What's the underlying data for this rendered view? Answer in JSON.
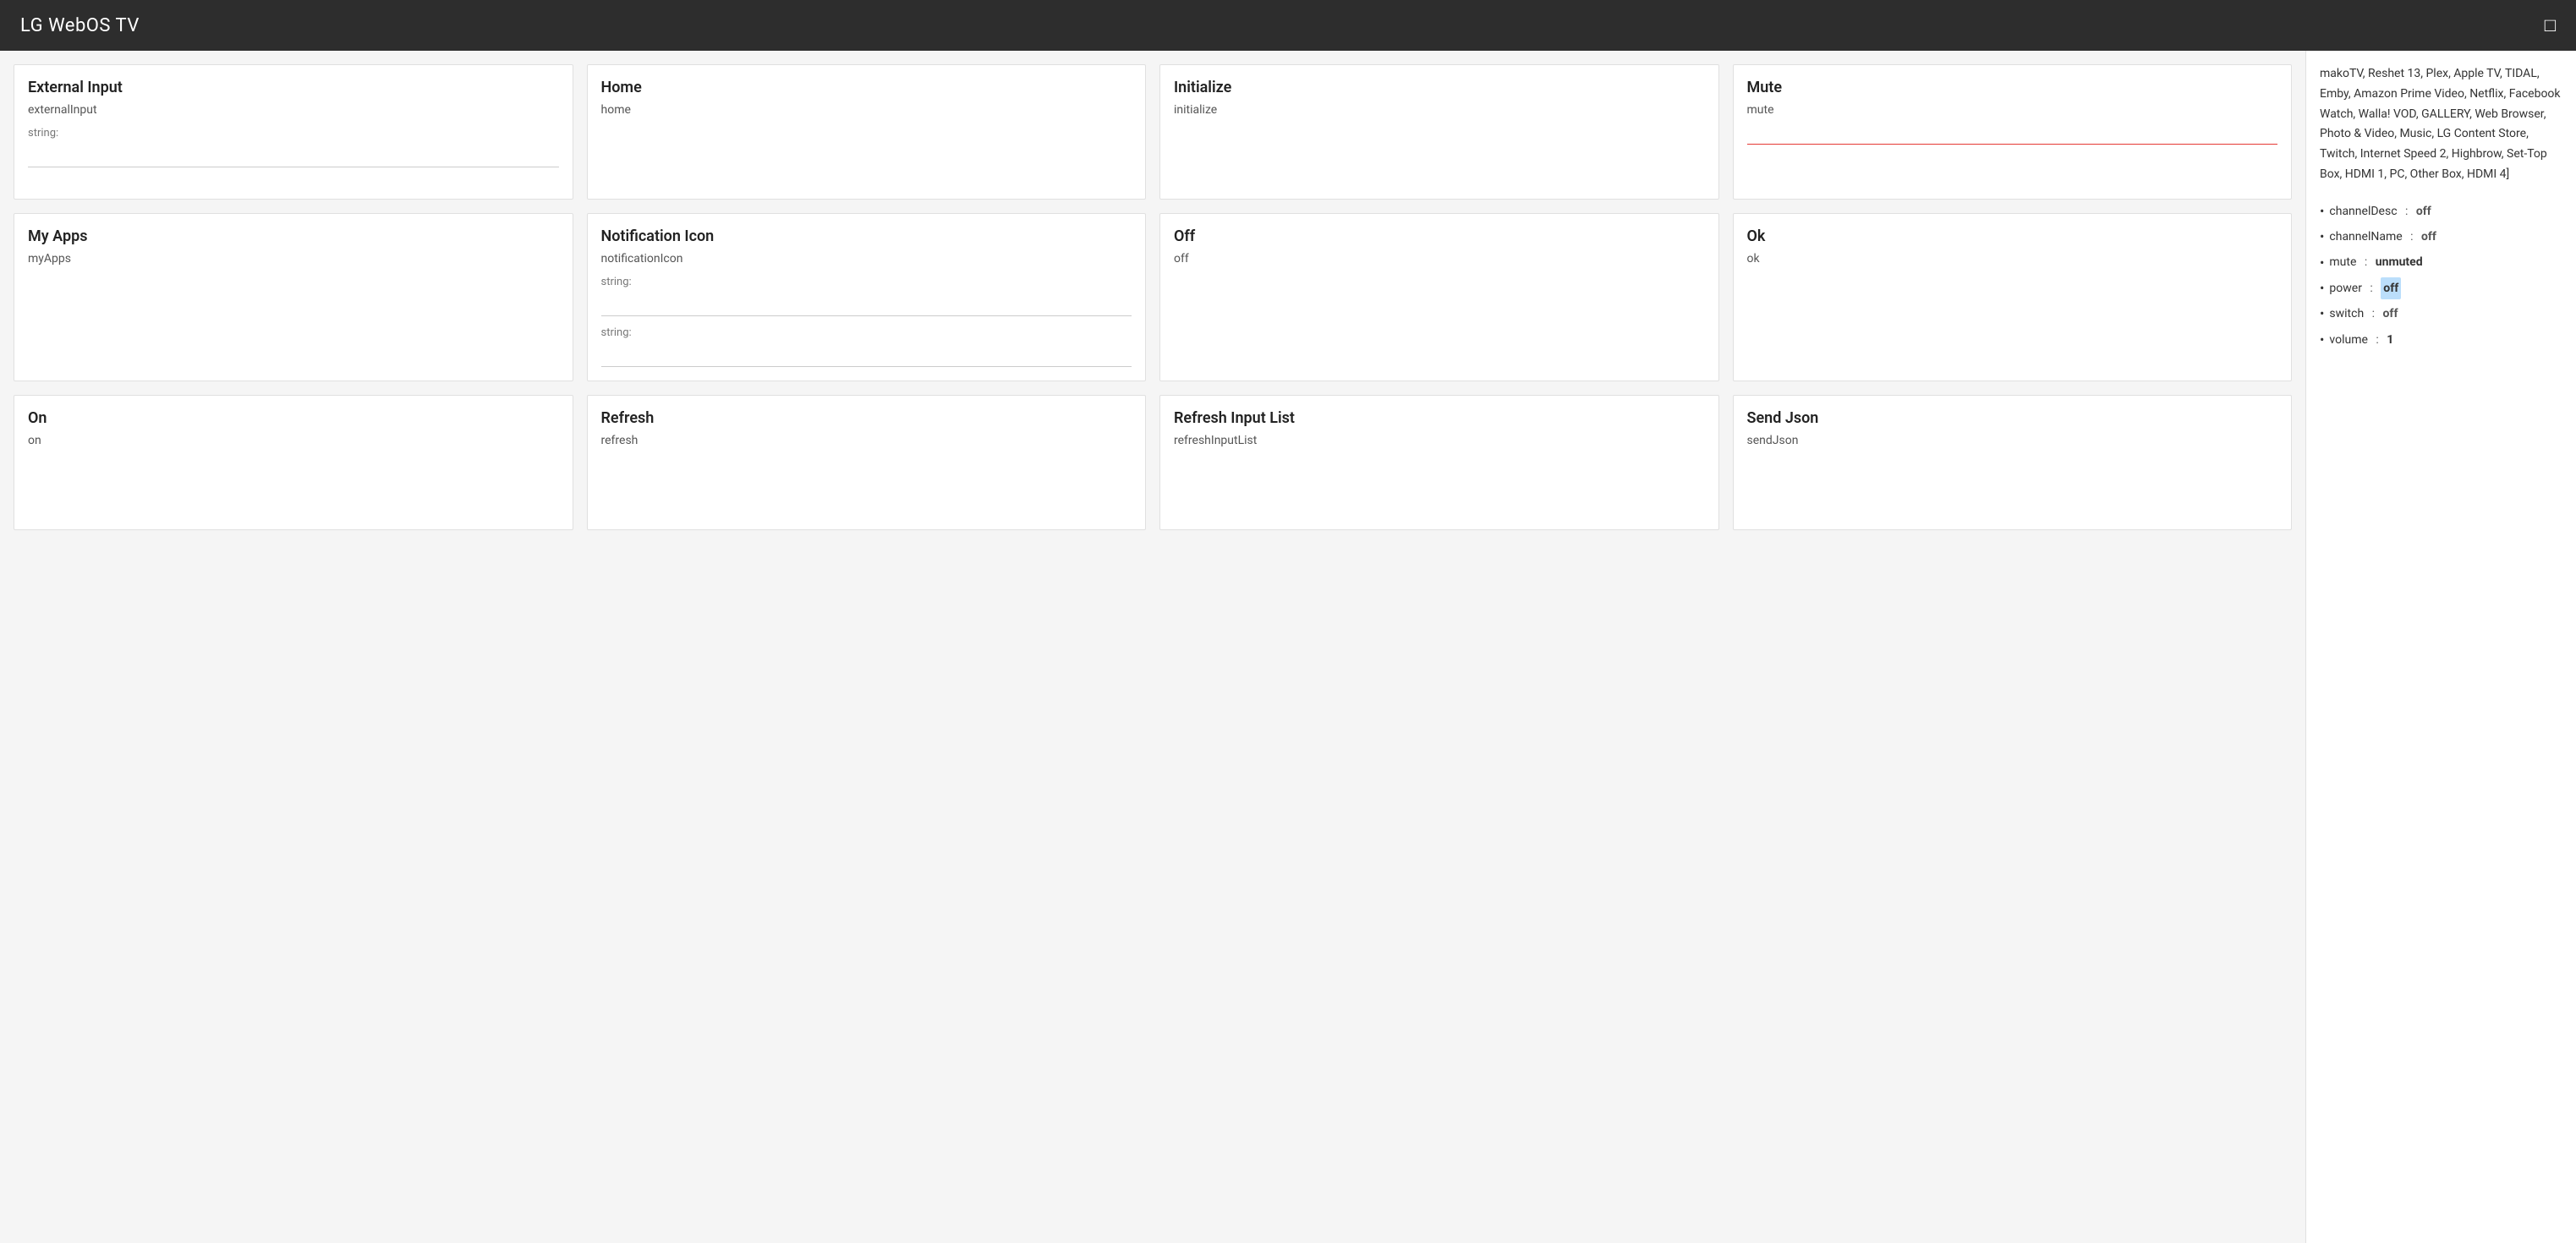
{
  "header": {
    "title": "LG WebOS TV",
    "chat_icon": "💬"
  },
  "sidebar": {
    "apps_text": "makoTV, Reshet 13, Plex, Apple TV, TIDAL, Emby, Amazon Prime Video, Netflix, Facebook Watch, Walla! VOD, GALLERY, Web Browser, Photo & Video, Music, LG Content Store, Twitch, Internet Speed 2, Highbrow, Set-Top Box, HDMI 1, PC, Other Box, HDMI 4]",
    "status": [
      {
        "key": "channelDesc",
        "value": "off",
        "bold": false
      },
      {
        "key": "channelName",
        "value": "off",
        "bold": false
      },
      {
        "key": "mute",
        "value": "unmuted",
        "bold": true
      },
      {
        "key": "power",
        "value": "off",
        "bold": false,
        "highlight": true
      },
      {
        "key": "switch",
        "value": "off",
        "bold": false
      },
      {
        "key": "volume",
        "value": "1",
        "bold": true
      }
    ]
  },
  "cards": [
    {
      "id": "external-input",
      "title": "External Input",
      "command": "externalInput",
      "inputs": [
        {
          "label": "string:",
          "value": "",
          "placeholder": "",
          "is_red": false
        }
      ]
    },
    {
      "id": "home",
      "title": "Home",
      "command": "home",
      "inputs": []
    },
    {
      "id": "initialize",
      "title": "Initialize",
      "command": "initialize",
      "inputs": []
    },
    {
      "id": "mute",
      "title": "Mute",
      "command": "mute",
      "inputs": [
        {
          "label": "",
          "value": "",
          "placeholder": "",
          "is_red": true
        }
      ]
    },
    {
      "id": "my-apps",
      "title": "My Apps",
      "command": "myApps",
      "inputs": []
    },
    {
      "id": "notification-icon",
      "title": "Notification Icon",
      "command": "notificationIcon",
      "inputs": [
        {
          "label": "string:",
          "value": "",
          "placeholder": "",
          "is_red": false
        },
        {
          "label": "string:",
          "value": "",
          "placeholder": "",
          "is_red": false
        }
      ]
    },
    {
      "id": "off",
      "title": "Off",
      "command": "off",
      "inputs": []
    },
    {
      "id": "ok",
      "title": "Ok",
      "command": "ok",
      "inputs": []
    },
    {
      "id": "on",
      "title": "On",
      "command": "on",
      "inputs": []
    },
    {
      "id": "refresh",
      "title": "Refresh",
      "command": "refresh",
      "inputs": []
    },
    {
      "id": "refresh-input-list",
      "title": "Refresh Input List",
      "command": "refreshInputList",
      "inputs": []
    },
    {
      "id": "send-json",
      "title": "Send Json",
      "command": "sendJson",
      "inputs": []
    }
  ]
}
